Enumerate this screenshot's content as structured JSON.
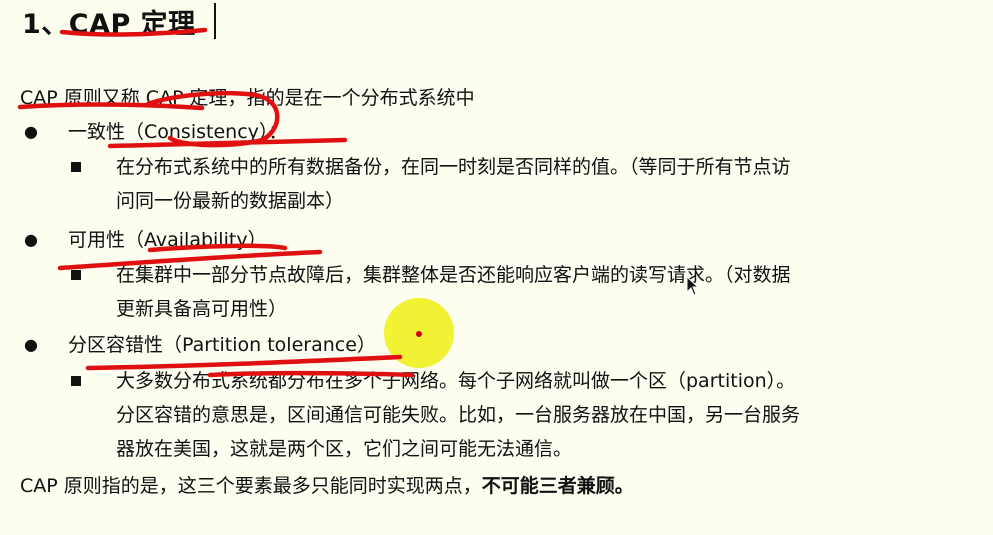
{
  "title": "1、CAP 定理",
  "intro": "CAP 原则又称 CAP 定理，指的是在一个分布式系统中",
  "items": [
    {
      "label": "一致性（Consistency）：",
      "desc_line1": "在分布式系统中的所有数据备份，在同一时刻是否同样的值。（等同于所有节点访",
      "desc_line2": "问同一份最新的数据副本）"
    },
    {
      "label": "可用性（Availability）",
      "desc_line1": "在集群中一部分节点故障后，集群整体是否还能响应客户端的读写请求。（对数据",
      "desc_line2": "更新具备高可用性）"
    },
    {
      "label": "分区容错性（Partition tolerance）",
      "desc_line1": "大多数分布式系统都分布在多个子网络。每个子网络就叫做一个区（partition）。",
      "desc_line2": "分区容错的意思是，区间通信可能失败。比如，一台服务器放在中国，另一台服务",
      "desc_line3": "器放在美国，这就是两个区，它们之间可能无法通信。"
    }
  ],
  "conclusion": {
    "normal": "CAP 原则指的是，这三个要素最多只能同时实现两点，",
    "bold": "不可能三者兼顾。"
  },
  "colors": {
    "background": "#fdfdf0",
    "annotation_red": "#e01010",
    "cursor_highlight": "#f0f014"
  }
}
